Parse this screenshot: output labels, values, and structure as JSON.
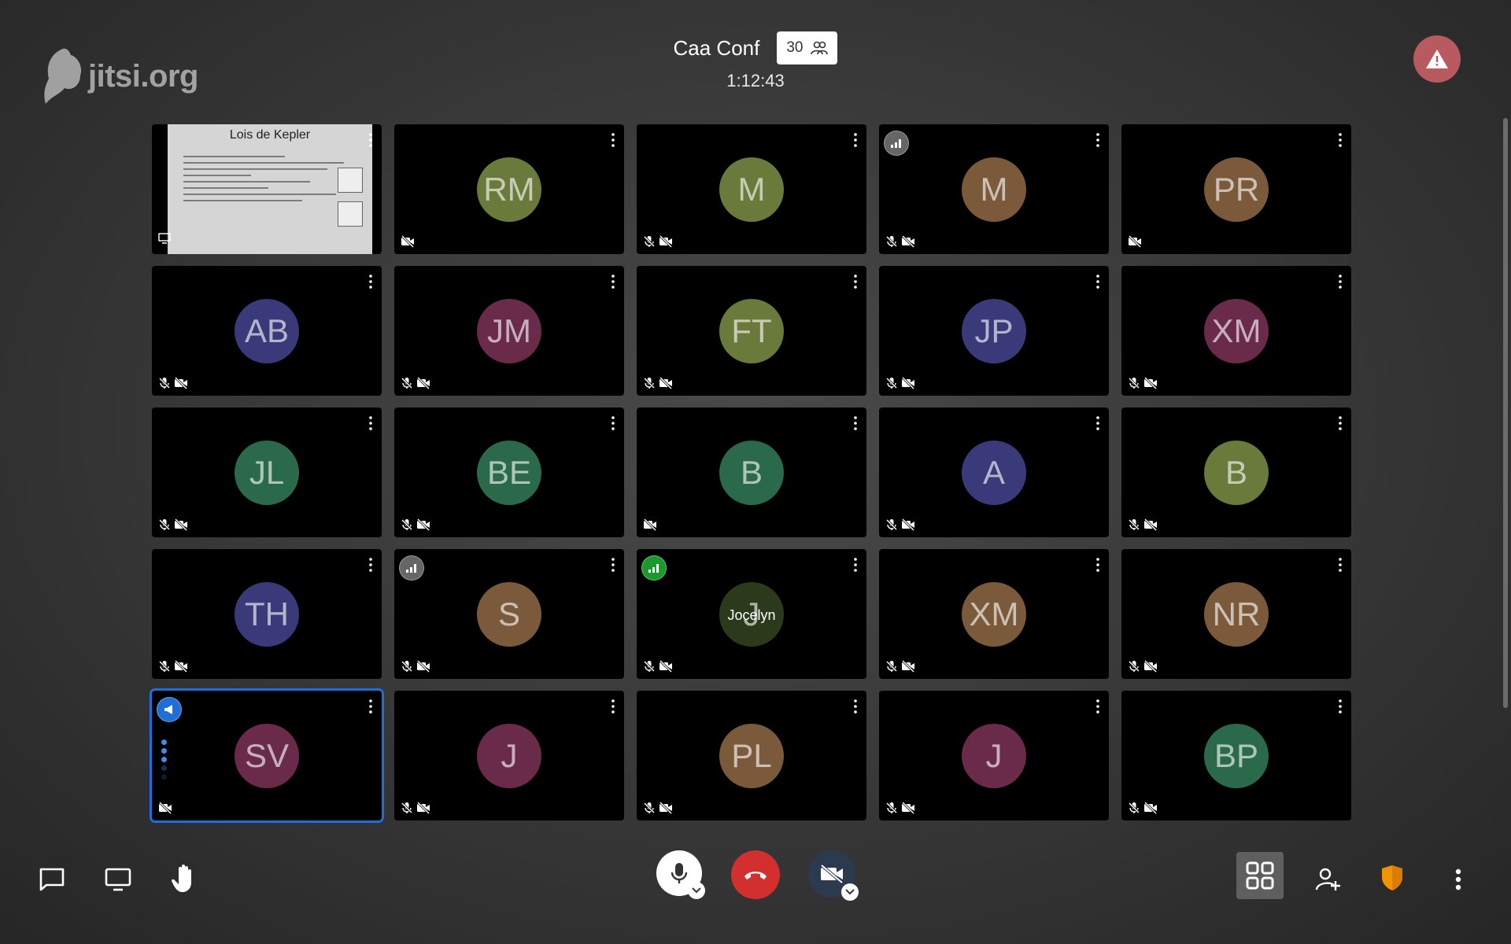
{
  "app": {
    "logo_text": "jitsi.org"
  },
  "header": {
    "title": "Caa Conf",
    "participant_count": "30",
    "timer": "1:12:43"
  },
  "tiles": [
    {
      "type": "screenshare",
      "slide_title": "Lois de Kepler"
    },
    {
      "initials": "RM",
      "color": "#6a7a3a",
      "mic_muted": false
    },
    {
      "initials": "M",
      "color": "#6a7a3a",
      "mic_muted": true
    },
    {
      "initials": "M",
      "color": "#7a5a3a",
      "mic_muted": true,
      "connection": "gray"
    },
    {
      "initials": "PR",
      "color": "#7a5a3a",
      "mic_muted": false
    },
    {
      "initials": "AB",
      "color": "#3a3a7a",
      "mic_muted": true
    },
    {
      "initials": "JM",
      "color": "#6a2a4a",
      "mic_muted": true
    },
    {
      "initials": "FT",
      "color": "#6a7a3a",
      "mic_muted": true
    },
    {
      "initials": "JP",
      "color": "#3a3a7a",
      "mic_muted": true
    },
    {
      "initials": "XM",
      "color": "#6a2a4a",
      "mic_muted": true
    },
    {
      "initials": "JL",
      "color": "#2a6a4a",
      "mic_muted": true
    },
    {
      "initials": "BE",
      "color": "#2a6a4a",
      "mic_muted": true
    },
    {
      "initials": "B",
      "color": "#2a6a4a",
      "mic_muted": false
    },
    {
      "initials": "A",
      "color": "#3a3a7a",
      "mic_muted": true
    },
    {
      "initials": "B",
      "color": "#6a7a3a",
      "mic_muted": true
    },
    {
      "initials": "TH",
      "color": "#3a3a7a",
      "mic_muted": true
    },
    {
      "initials": "S",
      "color": "#7a5a3a",
      "mic_muted": true,
      "connection": "gray"
    },
    {
      "initials": "J",
      "color": "#2a3a1a",
      "mic_muted": true,
      "connection": "green",
      "name": "Jocelyn"
    },
    {
      "initials": "XM",
      "color": "#7a5a3a",
      "mic_muted": true
    },
    {
      "initials": "NR",
      "color": "#7a5a3a",
      "mic_muted": true
    },
    {
      "initials": "SV",
      "color": "#6a2a4a",
      "mic_muted": false,
      "active": true,
      "moderator": true,
      "speaking": true
    },
    {
      "initials": "J",
      "color": "#6a2a4a",
      "mic_muted": true
    },
    {
      "initials": "PL",
      "color": "#7a5a3a",
      "mic_muted": true
    },
    {
      "initials": "J",
      "color": "#6a2a4a",
      "mic_muted": true
    },
    {
      "initials": "BP",
      "color": "#2a6a4a",
      "mic_muted": true
    }
  ],
  "toolbar": {
    "left": [
      "chat-icon",
      "screen-share-icon",
      "raise-hand-icon"
    ],
    "center": [
      "microphone-icon",
      "hangup-icon",
      "camera-off-icon"
    ],
    "right": [
      "tile-view-icon",
      "invite-icon",
      "security-icon",
      "more-icon"
    ],
    "colors": {
      "hangup": "#d32f2f",
      "security": "#f29400",
      "camera_bg": "#2b3a4e"
    }
  }
}
